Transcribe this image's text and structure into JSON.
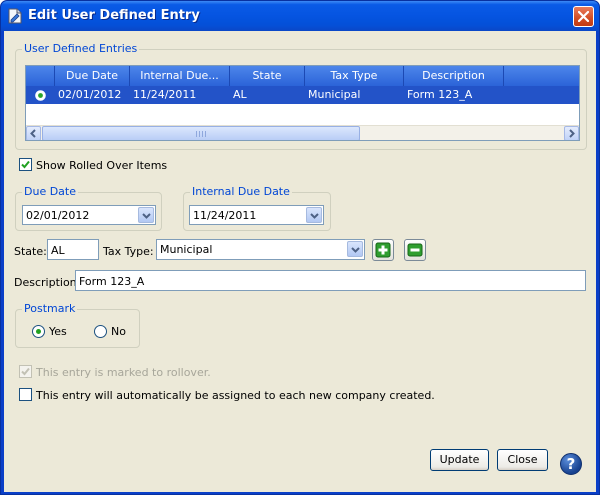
{
  "window": {
    "title": "Edit User Defined Entry"
  },
  "entries_group": {
    "legend": "User Defined Entries",
    "columns": [
      "",
      "Due Date",
      "Internal Due...",
      "State",
      "Tax Type",
      "Description"
    ],
    "rows": [
      {
        "due_date": "02/01/2012",
        "internal_due": "11/24/2011",
        "state": "AL",
        "tax_type": "Municipal",
        "description": "Form 123_A"
      }
    ]
  },
  "show_rolled_over": {
    "label": "Show Rolled Over Items",
    "checked": true
  },
  "due_date": {
    "legend": "Due Date",
    "value": "02/01/2012"
  },
  "internal_due_date": {
    "legend": "Internal Due Date",
    "value": "11/24/2011"
  },
  "state": {
    "label": "State:",
    "value": "AL"
  },
  "tax_type": {
    "label": "Tax Type:",
    "value": "Municipal"
  },
  "description": {
    "label": "Description:",
    "value": "Form 123_A"
  },
  "postmark": {
    "legend": "Postmark",
    "yes_label": "Yes",
    "no_label": "No",
    "selected": "Yes"
  },
  "rollover": {
    "label": "This entry is marked to rollover.",
    "checked": true,
    "disabled": true
  },
  "auto_assign": {
    "label": "This entry will automatically be assigned to each new company created.",
    "checked": false
  },
  "buttons": {
    "update": "Update",
    "close": "Close",
    "help": "?"
  },
  "colors": {
    "title_bar": "#0554e1",
    "selection": "#2353c8",
    "legend": "#0046d5",
    "dialog_bg": "#ece9d8"
  }
}
